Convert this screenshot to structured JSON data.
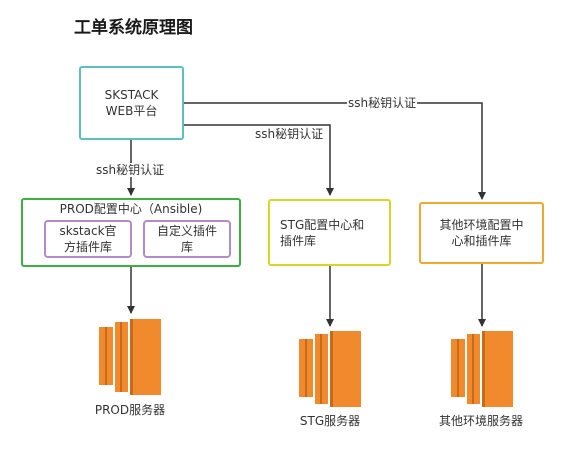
{
  "title": "工单系统原理图",
  "nodes": {
    "web": "SKSTACK\nWEB平台",
    "prod": "PROD配置中心（Ansible)",
    "skstack_lib": "skstack官\n方插件库",
    "custom_lib": "自定义插件\n库",
    "stg": "STG配置中心和\n插件库",
    "other": "其他环境配置中\n心和插件库"
  },
  "edges": {
    "to_prod": "ssh秘钥认证",
    "to_stg": "ssh秘钥认证",
    "to_other": "ssh秘钥认证"
  },
  "servers": {
    "prod": "PROD服务器",
    "stg": "STG服务器",
    "other": "其他环境服务器"
  },
  "colors": {
    "web_border": "#5bc0c0",
    "prod_border": "#3cb043",
    "plugin_border": "#b48ac8",
    "stg_border": "#d6d62a",
    "other_border": "#f0a830",
    "server_icon": "#f08a2c",
    "arrow": "#333333"
  },
  "icons": {
    "server": "aws-ec2-server-icon"
  }
}
